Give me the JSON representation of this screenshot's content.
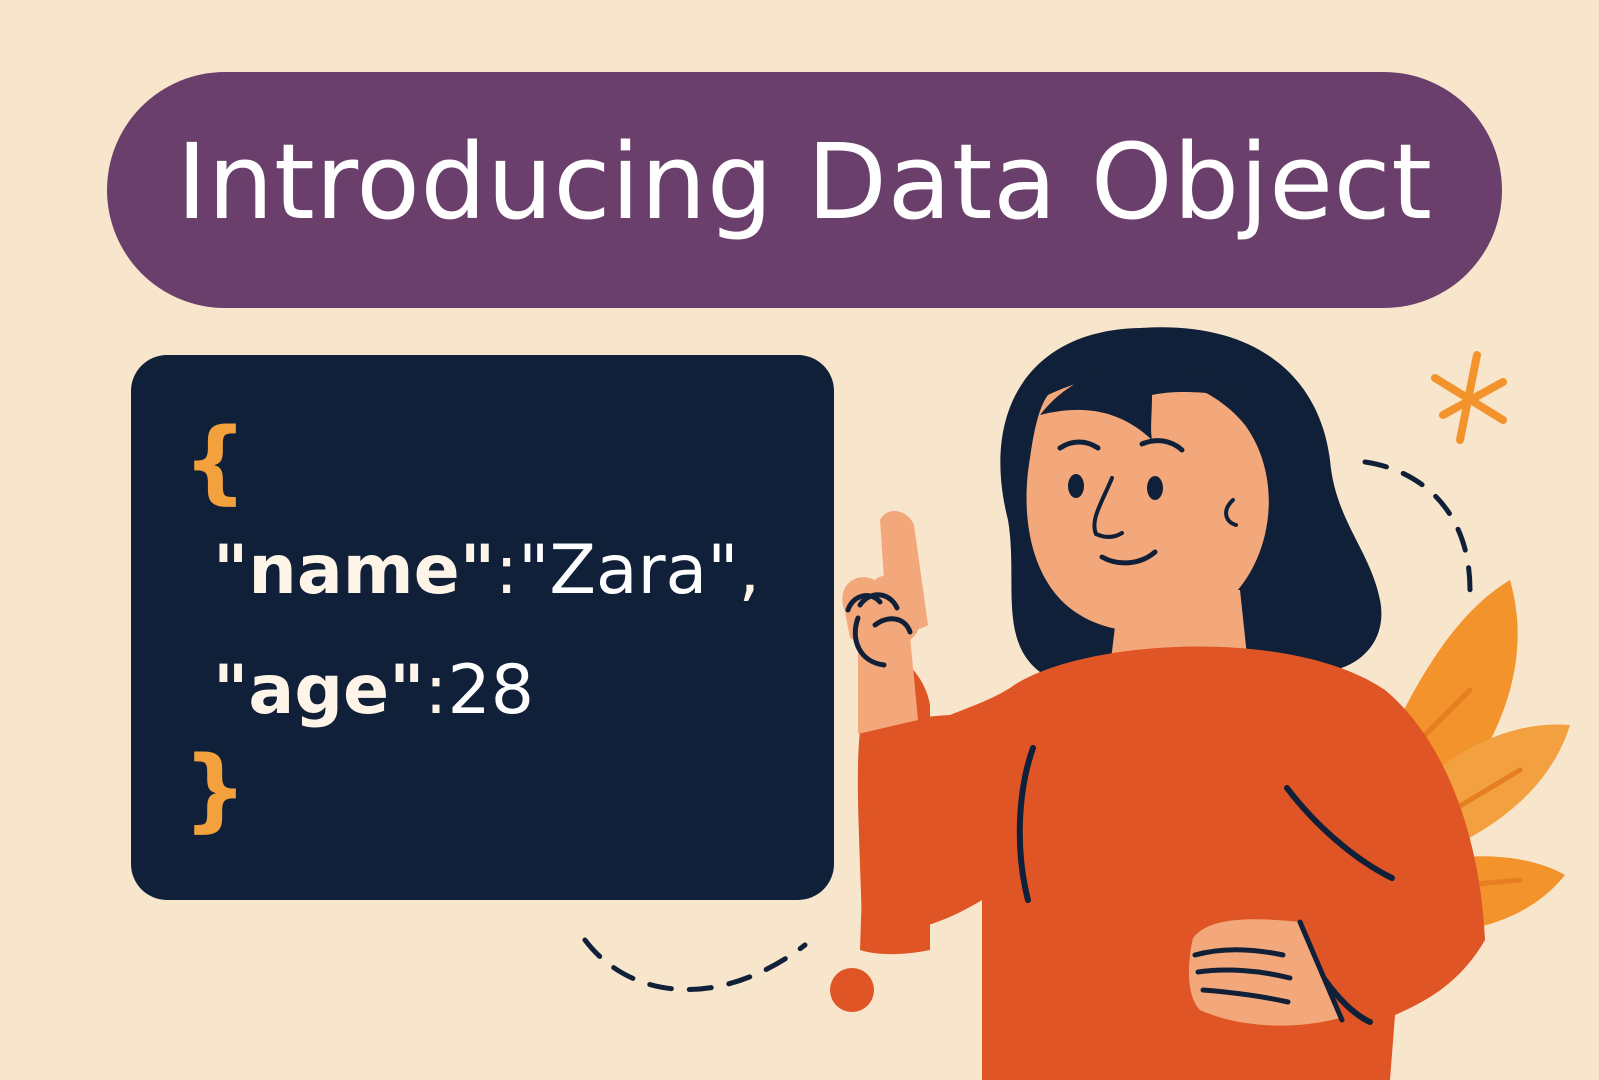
{
  "title": "Introducing Data Object",
  "code": {
    "open_brace": "{",
    "close_brace": "}",
    "lines": [
      {
        "key": "\"name\"",
        "separator": ":",
        "value": "\"Zara\"",
        "trailing": ","
      },
      {
        "key": "\"age\"",
        "separator": ":",
        "value": "28",
        "trailing": ""
      }
    ]
  },
  "colors": {
    "background": "#f8e6cc",
    "banner": "#6b3f6c",
    "code_panel": "#102038",
    "brace": "#f2a13c",
    "shirt": "#df5525",
    "skin": "#f3a87b",
    "hair": "#102038",
    "accent_orange": "#f3932b"
  },
  "icons": {
    "left_dot": "circle-dot-icon",
    "right_star": "sparkle-icon",
    "dashed_arc_left": "dashed-arc-icon",
    "dashed_arc_right": "dashed-arc-icon"
  }
}
